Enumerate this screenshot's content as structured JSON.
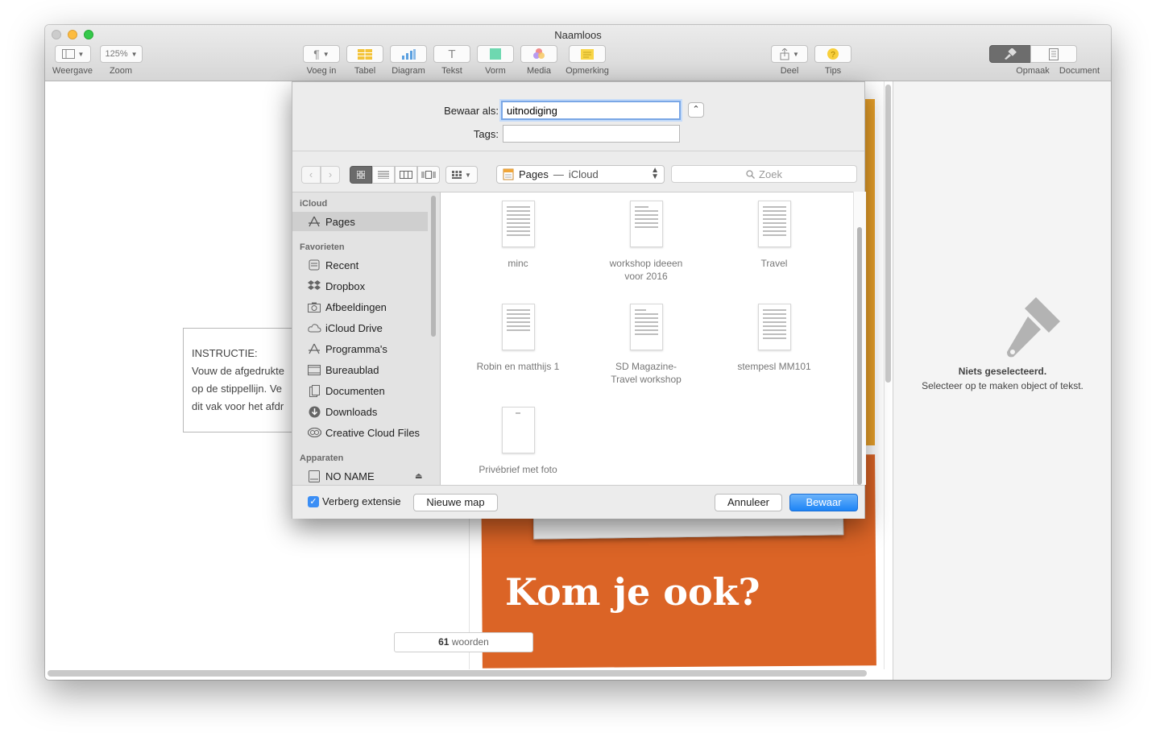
{
  "window": {
    "title": "Naamloos"
  },
  "toolbar": {
    "view_label": "Weergave",
    "zoom_value": "125%",
    "zoom_label": "Zoom",
    "insert_label": "Voeg in",
    "table_label": "Tabel",
    "chart_label": "Diagram",
    "text_label": "Tekst",
    "shape_label": "Vorm",
    "media_label": "Media",
    "comment_label": "Opmerking",
    "share_label": "Deel",
    "tips_label": "Tips",
    "format_label": "Opmaak",
    "document_label": "Document"
  },
  "canvas": {
    "instruction_title": "INSTRUCTIE:",
    "instruction_lines": [
      "Vouw de afgedrukte",
      "op de stippellijn. Ve",
      "dit vak voor het afdr"
    ],
    "headline": "Kom je ook?",
    "word_count": "61",
    "word_count_label": "woorden"
  },
  "inspector": {
    "title": "Niets geselecteerd.",
    "subtitle": "Selecteer op te maken object of tekst."
  },
  "dialog": {
    "save_as_label": "Bewaar als:",
    "save_as_value": "uitnodiging",
    "tags_label": "Tags:",
    "location_app": "Pages",
    "location_sep": "—",
    "location_place": "iCloud",
    "search_placeholder": "Zoek",
    "sidebar": {
      "icloud_header": "iCloud",
      "favorites_header": "Favorieten",
      "devices_header": "Apparaten",
      "items": [
        {
          "label": "Pages"
        },
        {
          "label": "Recent"
        },
        {
          "label": "Dropbox"
        },
        {
          "label": "Afbeeldingen"
        },
        {
          "label": "iCloud Drive"
        },
        {
          "label": "Programma's"
        },
        {
          "label": "Bureaublad"
        },
        {
          "label": "Documenten"
        },
        {
          "label": "Downloads"
        },
        {
          "label": "Creative Cloud Files"
        },
        {
          "label": "NO NAME"
        }
      ]
    },
    "files": [
      {
        "name": "minc"
      },
      {
        "name": "workshop ideeen\nvoor 2016"
      },
      {
        "name": "Travel"
      },
      {
        "name": "Robin en matthijs 1"
      },
      {
        "name": "SD Magazine-\nTravel workshop"
      },
      {
        "name": "stempesl MM101"
      },
      {
        "name": "Privébrief met foto"
      }
    ],
    "hide_extension_label": "Verberg extensie",
    "new_folder_label": "Nieuwe map",
    "cancel_label": "Annuleer",
    "save_label": "Bewaar"
  }
}
